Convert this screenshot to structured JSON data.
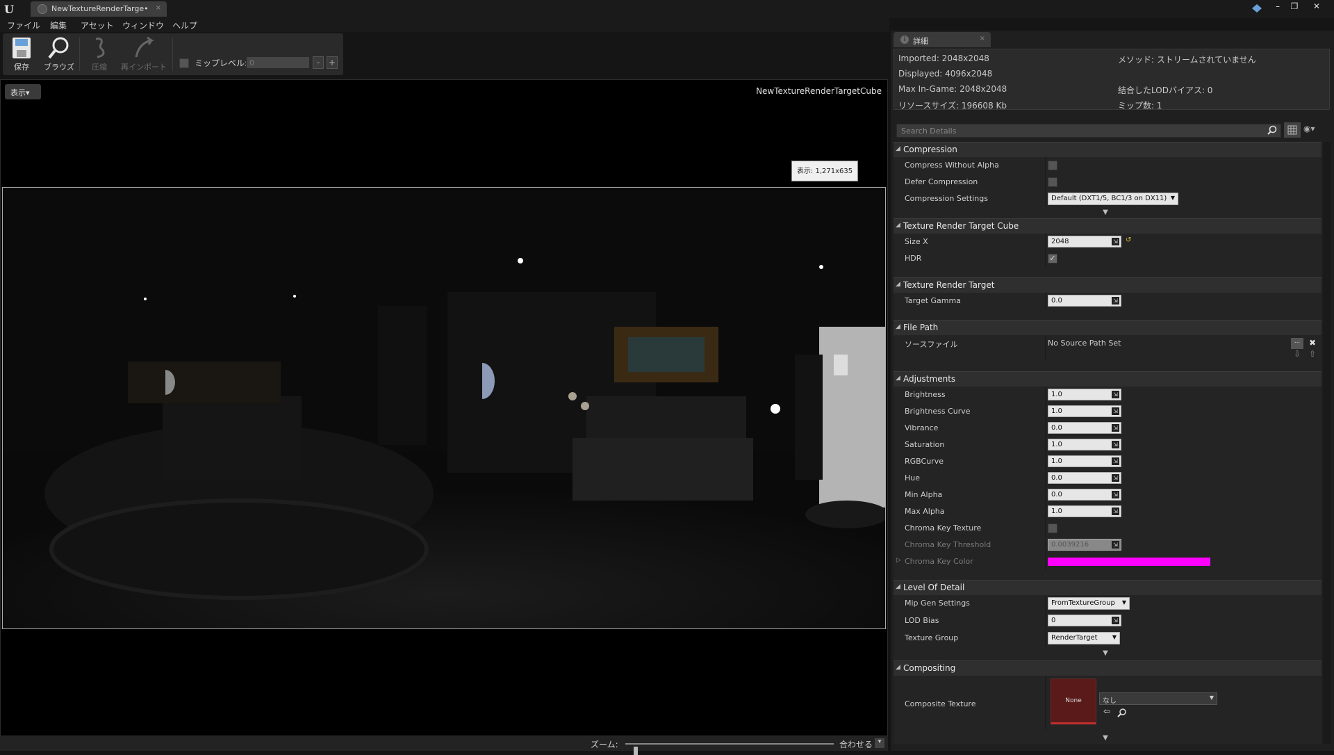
{
  "titlebar": {
    "tab_title": "NewTextureRenderTarge•",
    "tab_close": "×",
    "btn_min": "–",
    "btn_max": "❐",
    "btn_close": "✕"
  },
  "menu": {
    "file": "ファイル",
    "edit": "編集",
    "asset": "アセット",
    "window": "ウィンドウ",
    "help": "ヘルプ"
  },
  "toolbar": {
    "save": "保存",
    "browse": "ブラウズ",
    "compress": "圧縮",
    "reimport": "再インポート",
    "mip_label": "ミップレベル:",
    "mip_value": "0",
    "minus": "-",
    "plus": "+"
  },
  "viewport": {
    "view_button": "表示▾",
    "texture_name": "NewTextureRenderTargetCube",
    "tooltip": "表示: 1,271x635",
    "zoom_label": "ズーム:",
    "zoom_level": 0.05,
    "fit_label": "合わせる",
    "fit_arrow": "▾"
  },
  "details": {
    "tab_label": "詳細",
    "tab_icon": "i",
    "tab_close": "×",
    "info": {
      "imported": "Imported: 2048x2048",
      "displayed": "Displayed: 4096x2048",
      "max_ingame": "Max In-Game: 2048x2048",
      "resource_size": "リソースサイズ: 196608 Kb",
      "method": "メソッド: ストリームされていません",
      "lod_bias": "結合したLODバイアス: 0",
      "mip_count": "ミップ数: 1"
    },
    "search_placeholder": "Search Details",
    "eye": "◉▾"
  },
  "sections": {
    "compression": {
      "title": "Compression",
      "compress_without_alpha": "Compress Without Alpha",
      "defer_compression": "Defer Compression",
      "compression_settings": "Compression Settings",
      "compression_settings_value": "Default (DXT1/5, BC1/3 on DX11)"
    },
    "trt_cube": {
      "title": "Texture Render Target Cube",
      "size_x": "Size X",
      "size_x_value": "2048",
      "hdr": "HDR"
    },
    "trt": {
      "title": "Texture Render Target",
      "target_gamma": "Target Gamma",
      "target_gamma_value": "0.0"
    },
    "file_path": {
      "title": "File Path",
      "source_file": "ソースファイル",
      "source_file_value": "No Source Path Set",
      "browse_btn": "...",
      "clear_btn": "✖"
    },
    "adjustments": {
      "title": "Adjustments",
      "brightness": "Brightness",
      "brightness_value": "1.0",
      "brightness_curve": "Brightness Curve",
      "brightness_curve_value": "1.0",
      "vibrance": "Vibrance",
      "vibrance_value": "0.0",
      "saturation": "Saturation",
      "saturation_value": "1.0",
      "rgbcurve": "RGBCurve",
      "rgbcurve_value": "1.0",
      "hue": "Hue",
      "hue_value": "0.0",
      "min_alpha": "Min Alpha",
      "min_alpha_value": "0.0",
      "max_alpha": "Max Alpha",
      "max_alpha_value": "1.0",
      "chroma_key_texture": "Chroma Key Texture",
      "chroma_key_threshold": "Chroma Key Threshold",
      "chroma_key_threshold_value": "0.0039216",
      "chroma_key_color": "Chroma Key Color",
      "chroma_key_color_hex": "#ff00ff"
    },
    "lod": {
      "title": "Level Of Detail",
      "mip_gen": "Mip Gen Settings",
      "mip_gen_value": "FromTextureGroup",
      "lod_bias": "LOD Bias",
      "lod_bias_value": "0",
      "texture_group": "Texture Group",
      "texture_group_value": "RenderTarget"
    },
    "compositing": {
      "title": "Compositing",
      "composite_texture": "Composite Texture",
      "thumb_label": "None",
      "asset_value": "なし"
    }
  }
}
